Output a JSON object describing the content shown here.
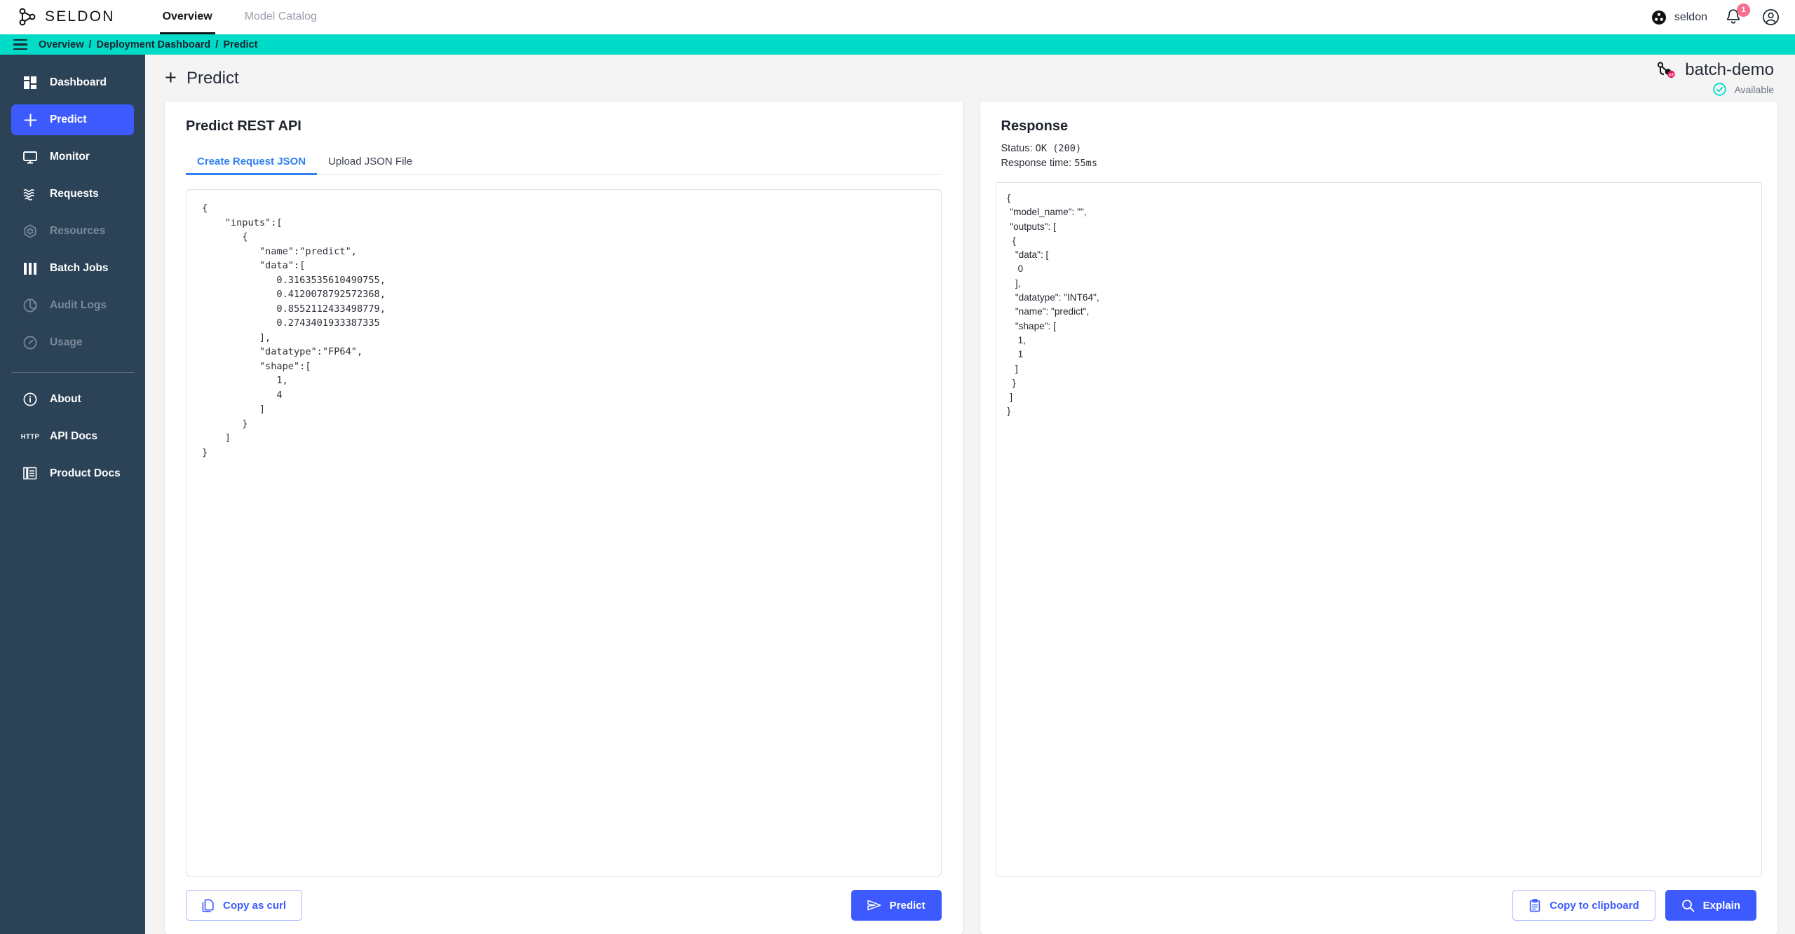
{
  "topbar": {
    "brand": "SELDON",
    "brand_icon": "seldon-logo-icon",
    "nav": [
      {
        "label": "Overview",
        "active": true
      },
      {
        "label": "Model Catalog",
        "active": false
      }
    ],
    "org_name": "seldon",
    "org_icon": "seldon-org-icon",
    "notifications_icon": "bell-icon",
    "notification_count": "1",
    "account_icon": "user-account-icon"
  },
  "breadcrumb": {
    "menu_icon": "hamburger-menu-icon",
    "items": [
      "Overview",
      "Deployment Dashboard",
      "Predict"
    ],
    "separator": "/"
  },
  "sidebar": {
    "items": [
      {
        "label": "Dashboard",
        "icon": "dashboard-grid-icon",
        "active": false,
        "disabled": false
      },
      {
        "label": "Predict",
        "icon": "plus-icon",
        "active": true,
        "disabled": false
      },
      {
        "label": "Monitor",
        "icon": "monitor-screen-icon",
        "active": false,
        "disabled": false
      },
      {
        "label": "Requests",
        "icon": "waves-icon",
        "active": false,
        "disabled": false
      },
      {
        "label": "Resources",
        "icon": "kubernetes-icon",
        "active": false,
        "disabled": true
      },
      {
        "label": "Batch Jobs",
        "icon": "bars-icon",
        "active": false,
        "disabled": false
      },
      {
        "label": "Audit Logs",
        "icon": "target-icon",
        "active": false,
        "disabled": true
      },
      {
        "label": "Usage",
        "icon": "gauge-icon",
        "active": false,
        "disabled": true
      }
    ],
    "footer_items": [
      {
        "label": "About",
        "icon": "info-circle-icon"
      },
      {
        "label": "API Docs",
        "icon": "http-icon"
      },
      {
        "label": "Product Docs",
        "icon": "documents-icon"
      }
    ]
  },
  "page": {
    "title": "Predict",
    "title_icon": "plus-icon",
    "deployment_name": "batch-demo",
    "deployment_icon": "deployment-v2-icon",
    "status_label": "Available",
    "status_icon": "check-circle-icon",
    "status_color": "#00dbc8"
  },
  "request_panel": {
    "title": "Predict REST API",
    "tabs": [
      {
        "label": "Create Request JSON",
        "active": true
      },
      {
        "label": "Upload JSON File",
        "active": false
      }
    ],
    "request_json": "{\n    \"inputs\":[\n       {\n          \"name\":\"predict\",\n          \"data\":[\n             0.3163535610490755,\n             0.4120078792572368,\n             0.8552112433498779,\n             0.2743401933387335\n          ],\n          \"datatype\":\"FP64\",\n          \"shape\":[\n             1,\n             4\n          ]\n       }\n    ]\n}",
    "copy_curl_label": "Copy as curl",
    "copy_curl_icon": "copy-icon",
    "predict_label": "Predict",
    "predict_icon": "send-icon"
  },
  "response_panel": {
    "title": "Response",
    "status_label": "Status:",
    "status_value": "OK (200)",
    "time_label": "Response time:",
    "time_value": "55ms",
    "response_json": "{\n \"model_name\": \"\",\n \"outputs\": [\n  {\n   \"data\": [\n    0\n   ],\n   \"datatype\": \"INT64\",\n   \"name\": \"predict\",\n   \"shape\": [\n    1,\n    1\n   ]\n  }\n ]\n}",
    "copy_clipboard_label": "Copy to clipboard",
    "copy_clipboard_icon": "clipboard-icon",
    "explain_label": "Explain",
    "explain_icon": "search-icon"
  },
  "colors": {
    "teal": "#00dbc8",
    "sidebar": "#2b4257",
    "accent_blue": "#3d5afe",
    "tab_blue": "#2f7ff0",
    "badge_pink": "#f76e8e"
  }
}
